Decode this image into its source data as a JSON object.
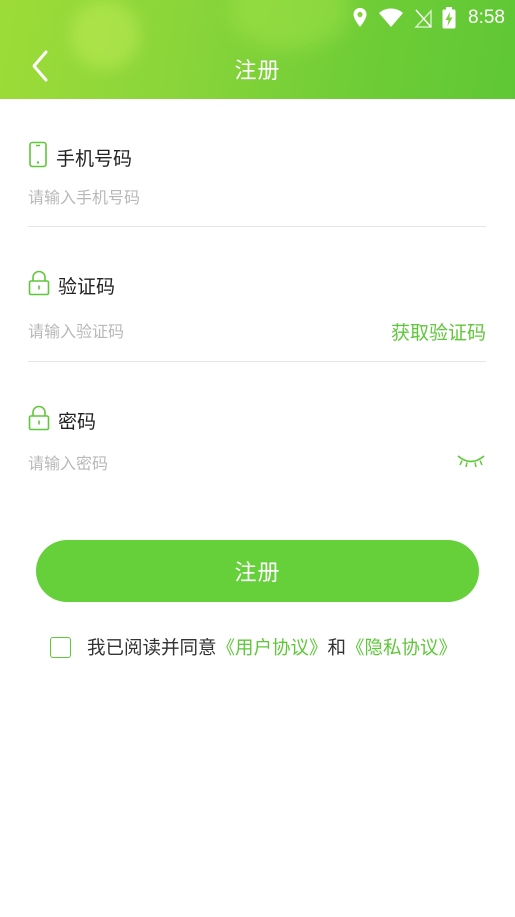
{
  "status_bar": {
    "time": "8:58",
    "icons": [
      "location-icon",
      "wifi-icon",
      "no-sim-icon",
      "battery-charging-icon"
    ]
  },
  "header": {
    "title": "注册",
    "back_icon": "chevron-left-icon"
  },
  "form": {
    "phone": {
      "label": "手机号码",
      "placeholder": "请输入手机号码",
      "icon": "phone-icon"
    },
    "code": {
      "label": "验证码",
      "placeholder": "请输入验证码",
      "icon": "lock-icon",
      "get_code_label": "获取验证码"
    },
    "password": {
      "label": "密码",
      "placeholder": "请输入密码",
      "icon": "lock-icon",
      "toggle_icon": "eye-closed-icon"
    }
  },
  "submit_label": "注册",
  "agreement": {
    "checked": false,
    "prefix": "我已阅读并同意",
    "user_agreement": "《用户协议》",
    "conjunction": "和",
    "privacy_agreement": "《隐私协议》"
  },
  "colors": {
    "accent": "#5fc73a",
    "button": "#66d03b",
    "header_start": "#9ddc38",
    "header_end": "#5fc735"
  }
}
